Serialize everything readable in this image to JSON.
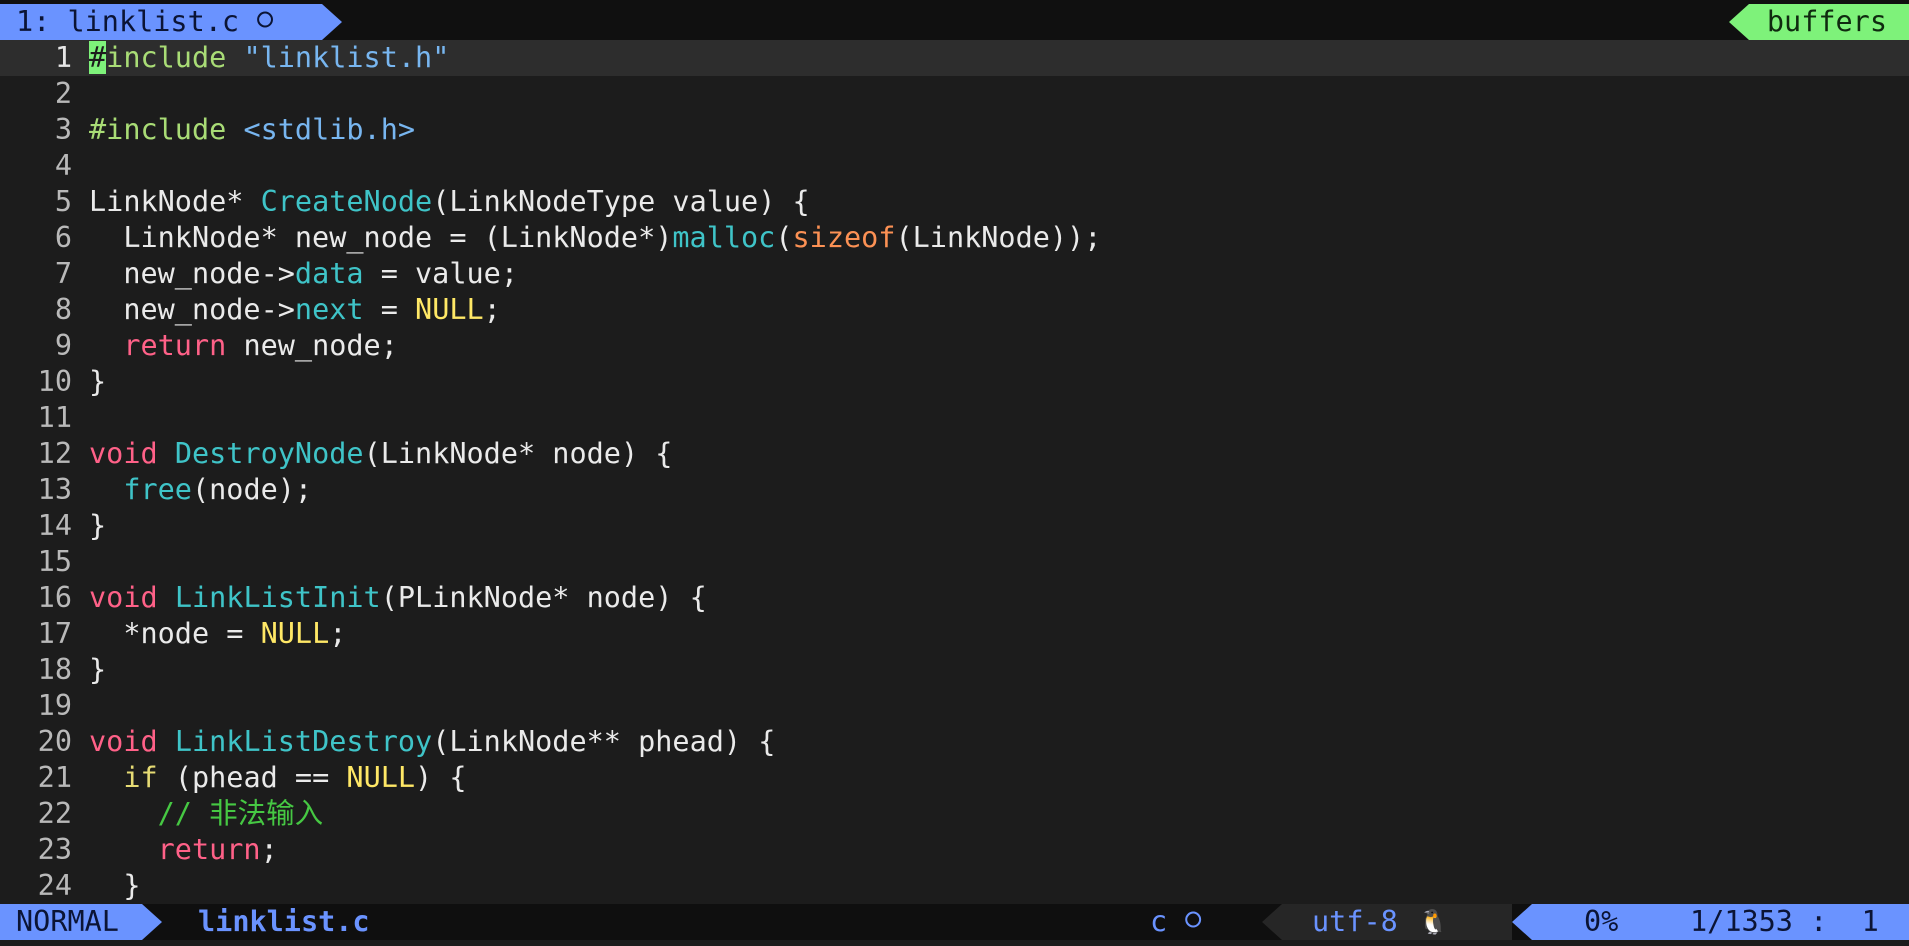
{
  "tabline": {
    "active_tab": "1: linklist.c",
    "buffers_label": "buffers"
  },
  "icons": {
    "filetype_icon": "c-language-icon",
    "os_icon": "linux-tux-icon"
  },
  "colors": {
    "accent_blue": "#6a93ff",
    "accent_green": "#7ef27a",
    "background": "#1c1c1c",
    "keyword": "#ff6188",
    "function": "#3fc4c8",
    "null_constant": "#ffe866",
    "comment": "#46c843"
  },
  "editor": {
    "lines": [
      {
        "n": "1",
        "current": true,
        "tokens": [
          {
            "t": "#",
            "c": "cursor"
          },
          {
            "t": "include ",
            "c": "pre"
          },
          {
            "t": "\"linklist.h\"",
            "c": "str"
          }
        ]
      },
      {
        "n": "2",
        "tokens": []
      },
      {
        "n": "3",
        "tokens": [
          {
            "t": "#include ",
            "c": "pre"
          },
          {
            "t": "<stdlib.h>",
            "c": "str"
          }
        ]
      },
      {
        "n": "4",
        "tokens": []
      },
      {
        "n": "5",
        "tokens": [
          {
            "t": "LinkNode* ",
            "c": "def"
          },
          {
            "t": "CreateNode",
            "c": "fn"
          },
          {
            "t": "(LinkNodeType value) {",
            "c": "def"
          }
        ]
      },
      {
        "n": "6",
        "tokens": [
          {
            "t": "  LinkNode* new_node = (LinkNode*)",
            "c": "def"
          },
          {
            "t": "malloc",
            "c": "fn"
          },
          {
            "t": "(",
            "c": "def"
          },
          {
            "t": "sizeof",
            "c": "sz"
          },
          {
            "t": "(LinkNode));",
            "c": "def"
          }
        ]
      },
      {
        "n": "7",
        "tokens": [
          {
            "t": "  new_node->",
            "c": "def"
          },
          {
            "t": "data",
            "c": "fn"
          },
          {
            "t": " = value;",
            "c": "def"
          }
        ]
      },
      {
        "n": "8",
        "tokens": [
          {
            "t": "  new_node->",
            "c": "def"
          },
          {
            "t": "next",
            "c": "fn"
          },
          {
            "t": " = ",
            "c": "def"
          },
          {
            "t": "NULL",
            "c": "null"
          },
          {
            "t": ";",
            "c": "def"
          }
        ]
      },
      {
        "n": "9",
        "tokens": [
          {
            "t": "  ",
            "c": "def"
          },
          {
            "t": "return",
            "c": "kw"
          },
          {
            "t": " new_node;",
            "c": "def"
          }
        ]
      },
      {
        "n": "10",
        "tokens": [
          {
            "t": "}",
            "c": "def"
          }
        ]
      },
      {
        "n": "11",
        "tokens": []
      },
      {
        "n": "12",
        "tokens": [
          {
            "t": "void",
            "c": "kw"
          },
          {
            "t": " ",
            "c": "def"
          },
          {
            "t": "DestroyNode",
            "c": "fn"
          },
          {
            "t": "(LinkNode* node) {",
            "c": "def"
          }
        ]
      },
      {
        "n": "13",
        "tokens": [
          {
            "t": "  ",
            "c": "def"
          },
          {
            "t": "free",
            "c": "fn"
          },
          {
            "t": "(node);",
            "c": "def"
          }
        ]
      },
      {
        "n": "14",
        "tokens": [
          {
            "t": "}",
            "c": "def"
          }
        ]
      },
      {
        "n": "15",
        "tokens": []
      },
      {
        "n": "16",
        "tokens": [
          {
            "t": "void",
            "c": "kw"
          },
          {
            "t": " ",
            "c": "def"
          },
          {
            "t": "LinkListInit",
            "c": "fn"
          },
          {
            "t": "(PLinkNode* node) {",
            "c": "def"
          }
        ]
      },
      {
        "n": "17",
        "tokens": [
          {
            "t": "  *node = ",
            "c": "def"
          },
          {
            "t": "NULL",
            "c": "null"
          },
          {
            "t": ";",
            "c": "def"
          }
        ]
      },
      {
        "n": "18",
        "tokens": [
          {
            "t": "}",
            "c": "def"
          }
        ]
      },
      {
        "n": "19",
        "tokens": []
      },
      {
        "n": "20",
        "tokens": [
          {
            "t": "void",
            "c": "kw"
          },
          {
            "t": " ",
            "c": "def"
          },
          {
            "t": "LinkListDestroy",
            "c": "fn"
          },
          {
            "t": "(LinkNode** phead) {",
            "c": "def"
          }
        ]
      },
      {
        "n": "21",
        "tokens": [
          {
            "t": "  ",
            "c": "def"
          },
          {
            "t": "if",
            "c": "cond"
          },
          {
            "t": " (phead == ",
            "c": "def"
          },
          {
            "t": "NULL",
            "c": "null"
          },
          {
            "t": ") {",
            "c": "def"
          }
        ]
      },
      {
        "n": "22",
        "tokens": [
          {
            "t": "    ",
            "c": "def"
          },
          {
            "t": "// 非法输入",
            "c": "cm"
          }
        ]
      },
      {
        "n": "23",
        "tokens": [
          {
            "t": "    ",
            "c": "def"
          },
          {
            "t": "return",
            "c": "kw"
          },
          {
            "t": ";",
            "c": "def"
          }
        ]
      },
      {
        "n": "24",
        "tokens": [
          {
            "t": "  }",
            "c": "def"
          }
        ]
      }
    ]
  },
  "statusline": {
    "mode": "NORMAL",
    "filename": "linklist.c",
    "filetype": "c",
    "encoding": "utf-8",
    "percent": "0%",
    "position": "1/1353 :  1"
  }
}
